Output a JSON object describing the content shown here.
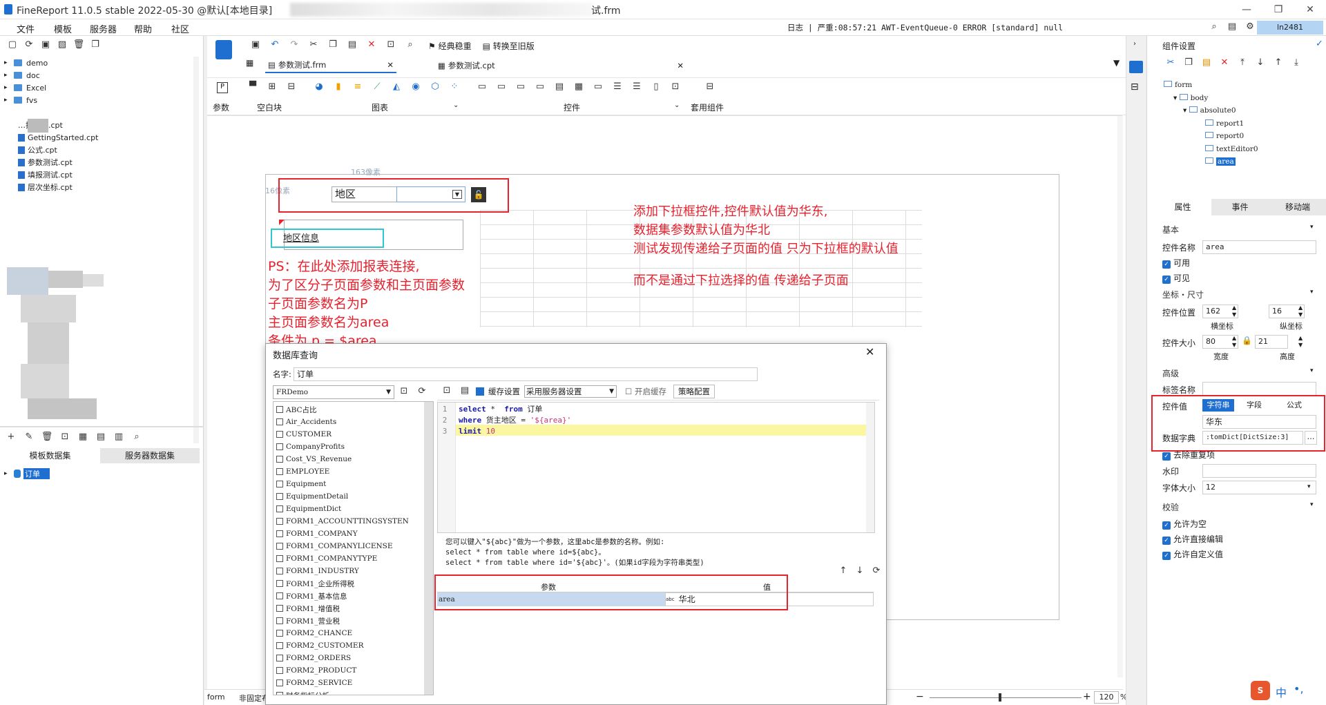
{
  "window": {
    "title": "FineReport 11.0.5 stable 2022-05-30 @默认[本地目录]",
    "title_suffix": "试.frm"
  },
  "menu": [
    "文件",
    "模板",
    "服务器",
    "帮助",
    "社区"
  ],
  "log_status": "日志 | 严重:08:57:21 AWT-EventQueue-0 ERROR [standard] null",
  "user": "ln2481",
  "file_tree": [
    "demo",
    "doc",
    "Excel",
    "fvs"
  ],
  "file_tree_files": [
    "…插入行.cpt",
    "GettingStarted.cpt",
    "公式.cpt",
    "参数测试.cpt",
    "填报测试.cpt",
    "层次坐标.cpt"
  ],
  "dataset_tabs": [
    "模板数据集",
    "服务器数据集"
  ],
  "dataset_item": "订单",
  "doc_tabs": [
    "参数测试.frm",
    "参数测试.cpt"
  ],
  "toolbar_top": {
    "classic": "经典稳重",
    "convert": "转换至旧版"
  },
  "widget_groups": {
    "param": "参数",
    "blank": "空白块",
    "chart": "图表",
    "control": "控件",
    "suite": "套用组件"
  },
  "canvas": {
    "width_hint": "163像素",
    "height_hint": "16像素",
    "label": "地区",
    "title_widget": "地区信息",
    "ps_notes": [
      "PS：在此处添加报表连接,",
      "为了区分子页面参数和主页面参数",
      "子页面参数名为P",
      "主页面参数名为area",
      "条件为 p = $area"
    ],
    "notes": [
      "添加下拉框控件,控件默认值为华东,",
      "数据集参数默认值为华北",
      "测试发现传递给子页面的值 只为下拉框的默认值",
      "而不是通过下拉选择的值 传递给子页面"
    ]
  },
  "dialog": {
    "title": "数据库查询",
    "name_label": "名字:",
    "name_value": "订单",
    "connection": "FRDemo",
    "cache_label": "缓存设置",
    "cache_value": "采用服务器设置",
    "enable_cache": "开启缓存",
    "strategy": "策略配置",
    "tables": [
      "ABC占比",
      "Air_Accidents",
      "CUSTOMER",
      "CompanyProfits",
      "Cost_VS_Revenue",
      "EMPLOYEE",
      "Equipment",
      "EquipmentDetail",
      "EquipmentDict",
      "FORM1_ACCOUNTTINGSYSTEN",
      "FORM1_COMPANY",
      "FORM1_COMPANYLICENSE",
      "FORM1_COMPANYTYPE",
      "FORM1_INDUSTRY",
      "FORM1_企业所得税",
      "FORM1_基本信息",
      "FORM1_增值税",
      "FORM1_营业税",
      "FORM2_CHANCE",
      "FORM2_CUSTOMER",
      "FORM2_ORDERS",
      "FORM2_PRODUCT",
      "FORM2_SERVICE",
      "财务指标分析"
    ],
    "sql_lines": [
      {
        "num": "1",
        "kw1": "select",
        "rest1": " *  ",
        "kw2": "from",
        "rest2": " 订单"
      },
      {
        "num": "2",
        "kw1": "where",
        "rest1": " 货主地区 = ",
        "str": "'${area}'"
      },
      {
        "num": "3",
        "kw1": "limit",
        "num_val": " 10"
      }
    ],
    "hint": [
      "您可以键入\"${abc}\"做为一个参数，这里abc是参数的名称。例如:",
      "select * from table where id=${abc}。",
      "select * from table where id='${abc}'。(如果id字段为字符串类型)"
    ],
    "param_header": "参数",
    "value_header": "值",
    "param_name": "area",
    "param_value": "华北"
  },
  "right": {
    "title": "组件设置",
    "tree": [
      "form",
      "body",
      "absolute0",
      "report1",
      "report0",
      "textEditor0",
      "area"
    ],
    "tabs": [
      "属性",
      "事件",
      "移动端"
    ],
    "basic": "基本",
    "name_label": "控件名称",
    "name_value": "area",
    "enabled": "可用",
    "visible": "可见",
    "coord_section": "坐标・尺寸",
    "pos_label": "控件位置",
    "pos_x": "162",
    "pos_y": "16",
    "x_label": "横坐标",
    "y_label": "纵坐标",
    "size_label": "控件大小",
    "width": "80",
    "height": "21",
    "w_label": "宽度",
    "h_label": "高度",
    "advanced": "高级",
    "tag_label": "标签名称",
    "value_label": "控件值",
    "value_types": [
      "字符串",
      "字段",
      "公式"
    ],
    "value": "华东",
    "dict_label": "数据字典",
    "dict_value": ":tomDict[DictSize:3]",
    "dedupe": "去除重复项",
    "watermark": "水印",
    "fontsize_label": "字体大小",
    "fontsize": "12",
    "validate": "校验",
    "allow_empty": "允许为空",
    "allow_edit": "允许直接编辑",
    "allow_custom": "允许自定义值"
  },
  "status": {
    "left": "form",
    "mode": "非固定布",
    "zoom": "120",
    "pct": "%"
  },
  "ime": "中"
}
